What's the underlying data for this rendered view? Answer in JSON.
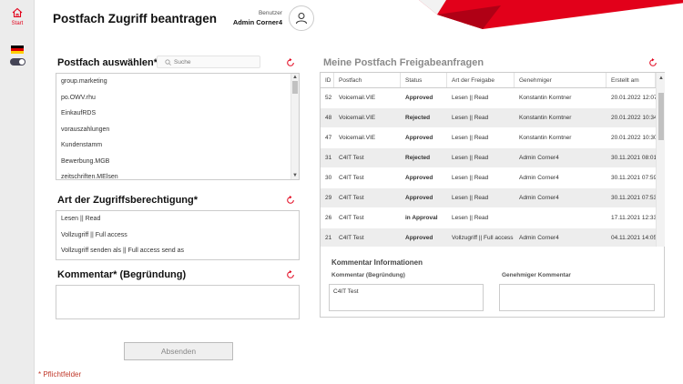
{
  "sidebar": {
    "start_label": "Start"
  },
  "header": {
    "title": "Postfach Zugriff beantragen",
    "user_role": "Benutzer",
    "user_name": "Admin Corner4"
  },
  "mailbox_section": {
    "title": "Postfach auswählen*",
    "search_placeholder": "Suche",
    "items": [
      "group.marketing",
      "po.OWV.rhu",
      "EinkaufRDS",
      "vorauszahlungen",
      "Kundenstamm",
      "Bewerbung.MGB",
      "zeitschriften.MElsen"
    ]
  },
  "access_section": {
    "title": "Art der Zugriffsberechtigung*",
    "items": [
      "Lesen || Read",
      "Vollzugriff || Full access",
      "Vollzugriff senden als || Full access send as"
    ]
  },
  "comment_section": {
    "title": "Kommentar* (Begründung)",
    "value": ""
  },
  "submit_label": "Absenden",
  "required_note": "* Pflichtfelder",
  "requests": {
    "title": "Meine Postfach Freigabeanfragen",
    "columns": [
      "ID",
      "Postfach",
      "Status",
      "Art der Freigabe",
      "Genehmiger",
      "Erstellt am"
    ],
    "rows": [
      {
        "id": "52",
        "postfach": "Voicemail.VIE",
        "status": "Approved",
        "art": "Lesen || Read",
        "genehmiger": "Konstantin Korntner",
        "erstellt": "20.01.2022 12:07"
      },
      {
        "id": "48",
        "postfach": "Voicemail.VIE",
        "status": "Rejected",
        "art": "Lesen || Read",
        "genehmiger": "Konstantin Korntner",
        "erstellt": "20.01.2022 10:34"
      },
      {
        "id": "47",
        "postfach": "Voicemail.VIE",
        "status": "Approved",
        "art": "Lesen || Read",
        "genehmiger": "Konstantin Korntner",
        "erstellt": "20.01.2022 10:30"
      },
      {
        "id": "31",
        "postfach": "C4IT Test",
        "status": "Rejected",
        "art": "Lesen || Read",
        "genehmiger": "Admin Corner4",
        "erstellt": "30.11.2021 08:01"
      },
      {
        "id": "30",
        "postfach": "C4IT Test",
        "status": "Approved",
        "art": "Lesen || Read",
        "genehmiger": "Admin Corner4",
        "erstellt": "30.11.2021 07:59"
      },
      {
        "id": "29",
        "postfach": "C4IT Test",
        "status": "Approved",
        "art": "Lesen || Read",
        "genehmiger": "Admin Corner4",
        "erstellt": "30.11.2021 07:53"
      },
      {
        "id": "26",
        "postfach": "C4IT Test",
        "status": "in Approval",
        "art": "Lesen || Read",
        "genehmiger": "",
        "erstellt": "17.11.2021 12:33"
      },
      {
        "id": "21",
        "postfach": "C4IT Test",
        "status": "Approved",
        "art": "Vollzugriff || Full access",
        "genehmiger": "Admin Corner4",
        "erstellt": "04.11.2021 14:05"
      }
    ]
  },
  "comment_info": {
    "title": "Kommentar Informationen",
    "comment_label": "Kommentar (Begründung)",
    "comment_value": "C4IT Test",
    "approver_label": "Genehmiger Kommentar",
    "approver_value": ""
  },
  "colors": {
    "accent": "#e2001a",
    "approved": "#2e7d32",
    "rejected": "#c62828"
  }
}
